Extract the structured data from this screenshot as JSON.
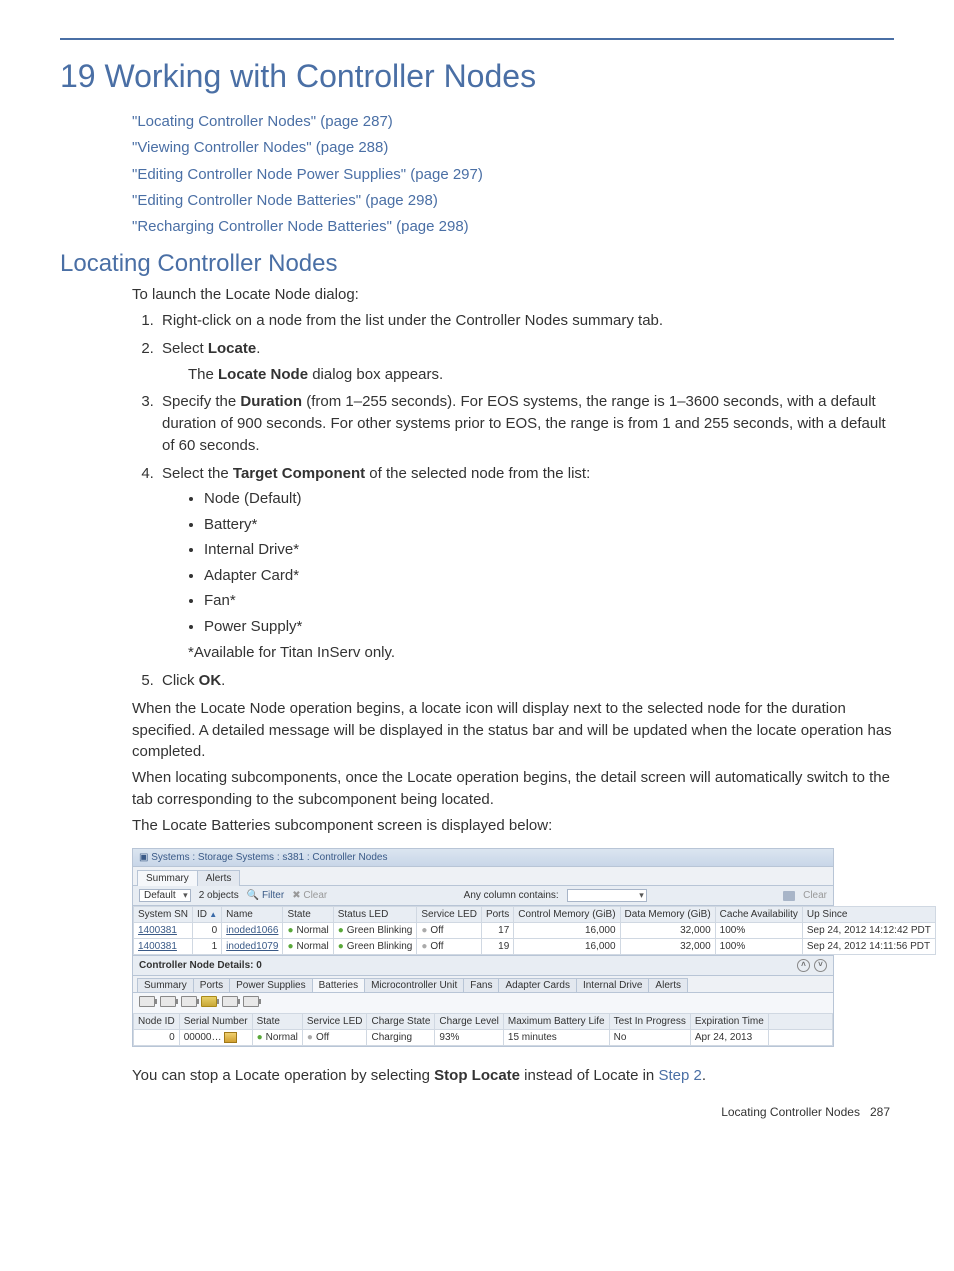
{
  "chapter": {
    "title": "19 Working with Controller Nodes",
    "toc": [
      "\"Locating Controller Nodes\" (page 287)",
      "\"Viewing Controller Nodes\" (page 288)",
      "\"Editing Controller Node Power Supplies\" (page 297)",
      "\"Editing Controller Node Batteries\" (page 298)",
      "\"Recharging Controller Node Batteries\" (page 298)"
    ]
  },
  "section": {
    "title": "Locating Controller Nodes",
    "intro": "To launch the Locate Node dialog:",
    "steps": {
      "s1": "Right-click on a node from the list under the Controller Nodes summary tab.",
      "s2_prefix": "Select ",
      "s2_bold": "Locate",
      "s2_suffix": ".",
      "s2_sub_prefix": "The ",
      "s2_sub_bold": "Locate Node",
      "s2_sub_suffix": " dialog box appears.",
      "s3_prefix": "Specify the ",
      "s3_bold": "Duration",
      "s3_suffix": " (from 1–255 seconds). For EOS systems, the range is 1–3600 seconds, with a default duration of 900 seconds. For other systems prior to EOS, the range is from 1 and 255 seconds, with a default of 60 seconds.",
      "s4_prefix": "Select the ",
      "s4_bold": "Target Component",
      "s4_suffix": " of the selected node from the list:",
      "s4_bullets": [
        "Node (Default)",
        "Battery*",
        "Internal Drive*",
        "Adapter Card*",
        "Fan*",
        "Power Supply*"
      ],
      "s4_note": "*Available for Titan InServ only.",
      "s5_prefix": "Click ",
      "s5_bold": "OK",
      "s5_suffix": "."
    },
    "para1": "When the Locate Node operation begins, a locate icon will display next to the selected node for the duration specified. A detailed message will be displayed in the status bar and will be updated when the locate operation has completed.",
    "para2": "When locating subcomponents, once the Locate operation begins, the detail screen will automatically switch to the tab corresponding to the subcomponent being located.",
    "para3": "The Locate Batteries subcomponent screen is displayed below:",
    "closing_prefix": "You can stop a Locate operation by selecting ",
    "closing_bold": "Stop Locate",
    "closing_mid": " instead of Locate in ",
    "closing_link": "Step 2",
    "closing_suffix": "."
  },
  "screenshot": {
    "titlebar": "Systems : Storage Systems : s381 : Controller Nodes",
    "tabs": {
      "summary": "Summary",
      "alerts": "Alerts"
    },
    "filterbar": {
      "default": "Default",
      "objects": "2 objects",
      "filter": "Filter",
      "clear": "Clear",
      "anycol": "Any column contains:",
      "clear2": "Clear"
    },
    "table1": {
      "headers": {
        "syssn": "System SN",
        "id": "ID",
        "name": "Name",
        "state": "State",
        "statusled": "Status LED",
        "serviceled": "Service LED",
        "ports": "Ports",
        "ctrlmem": "Control Memory (GiB)",
        "datamem": "Data Memory (GiB)",
        "cacheavail": "Cache Availability",
        "upsince": "Up Since"
      },
      "rows": [
        {
          "syssn": "1400381",
          "id": "0",
          "name": "inoded1066",
          "state": "Normal",
          "statusled": "Green Blinking",
          "serviceled": "Off",
          "ports": "17",
          "ctrlmem": "16,000",
          "datamem": "32,000",
          "cache": "100%",
          "upsince": "Sep 24, 2012 14:12:42 PDT"
        },
        {
          "syssn": "1400381",
          "id": "1",
          "name": "inoded1079",
          "state": "Normal",
          "statusled": "Green Blinking",
          "serviceled": "Off",
          "ports": "19",
          "ctrlmem": "16,000",
          "datamem": "32,000",
          "cache": "100%",
          "upsince": "Sep 24, 2012 14:11:56 PDT"
        }
      ]
    },
    "details_title": "Controller Node Details: 0",
    "subtabs": [
      "Summary",
      "Ports",
      "Power Supplies",
      "Batteries",
      "Microcontroller Unit",
      "Fans",
      "Adapter Cards",
      "Internal Drive",
      "Alerts"
    ],
    "active_subtab_index": 3,
    "table2": {
      "headers": {
        "nodeid": "Node ID",
        "serial": "Serial Number",
        "state": "State",
        "serviceled": "Service LED",
        "chargestate": "Charge State",
        "chargelevel": "Charge Level",
        "maxbatt": "Maximum Battery Life",
        "testin": "Test In Progress",
        "exptime": "Expiration Time"
      },
      "row": {
        "nodeid": "0",
        "serial": "00000…",
        "state": "Normal",
        "serviceled": "Off",
        "chargestate": "Charging",
        "chargelevel": "93%",
        "maxbatt": "15 minutes",
        "testin": "No",
        "exptime": "Apr 24, 2013"
      }
    }
  },
  "footer": {
    "text": "Locating Controller Nodes",
    "page": "287"
  }
}
